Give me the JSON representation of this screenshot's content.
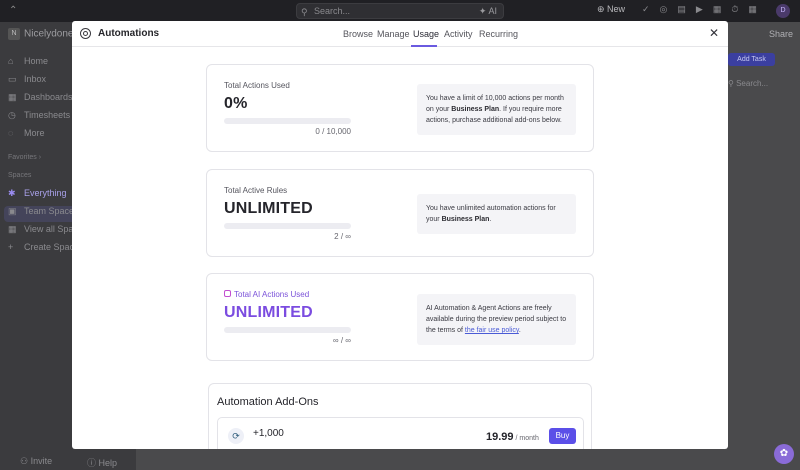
{
  "app": {
    "search_placeholder": "Search...",
    "search_ai": "AI",
    "new_label": "New",
    "avatar_initial": "D",
    "share_label": "Share",
    "add_task_label": "Add Task",
    "search_tasks_placeholder": "Search..."
  },
  "sidebar": {
    "workspace_initial": "N",
    "workspace_name": "Nicelydone",
    "items": [
      {
        "label": "Home",
        "icon": "home-icon"
      },
      {
        "label": "Inbox",
        "icon": "inbox-icon"
      },
      {
        "label": "Dashboards",
        "icon": "dashboards-icon"
      },
      {
        "label": "Timesheets",
        "icon": "timesheets-icon"
      },
      {
        "label": "More",
        "icon": "more-icon"
      }
    ],
    "favorites_label": "Favorites",
    "spaces_label": "Spaces",
    "spaces": [
      {
        "label": "Everything",
        "icon": "everything-icon"
      },
      {
        "label": "Team Space",
        "icon": "team-space-icon"
      },
      {
        "label": "View all Spaces",
        "icon": "grid-icon"
      },
      {
        "label": "Create Space",
        "icon": "plus-icon"
      }
    ],
    "invite_label": "Invite",
    "help_label": "Help"
  },
  "modal": {
    "title": "Automations",
    "tabs": [
      "Browse",
      "Manage",
      "Usage",
      "Activity",
      "Recurring"
    ],
    "active_tab": "Usage",
    "cards": [
      {
        "label": "Total Actions Used",
        "value": "0%",
        "progress": 0,
        "count": "0 / 10,000",
        "note_1": "You have a limit of 10,000 actions per month on your ",
        "note_bold": "Business Plan",
        "note_2": ". If you require more actions, purchase additional add-ons below."
      },
      {
        "label": "Total Active Rules",
        "value": "UNLIMITED",
        "progress": 0,
        "count": "2 / ∞",
        "note_1": "You have unlimited automation actions for your ",
        "note_bold": "Business Plan",
        "note_2": "."
      },
      {
        "label": "Total AI Actions Used",
        "value": "UNLIMITED",
        "progress": 0,
        "count": "∞ / ∞",
        "note_1": "AI Automation & Agent Actions are freely available during the preview period subject to the terms of ",
        "note_link": "the fair use policy",
        "note_2": "."
      }
    ],
    "addons": {
      "title": "Automation Add-Ons",
      "quantity": "+1,000",
      "price": "19.99",
      "period": "/ month",
      "buy_label": "Buy"
    }
  },
  "colors": {
    "accent": "#7b68ee",
    "ai_purple": "#7b4ce0",
    "buy_button": "#5b4fe8",
    "link": "#4a5bd6"
  }
}
